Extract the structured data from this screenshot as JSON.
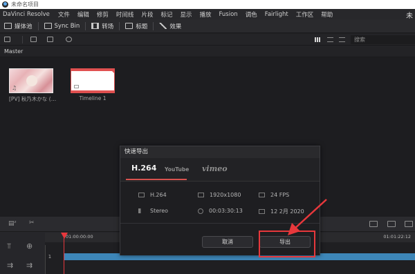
{
  "window": {
    "title": "未命名项目"
  },
  "menu": {
    "app": "DaVinci Resolve",
    "items": [
      "文件",
      "编辑",
      "修剪",
      "时间线",
      "片段",
      "标记",
      "显示",
      "播放",
      "Fusion",
      "调色",
      "Fairlight",
      "工作区",
      "帮助"
    ],
    "corner_text": "未"
  },
  "toolbar": {
    "media_pool": "媒体池",
    "sync_bin": "Sync Bin",
    "transitions": "转场",
    "titles": "标题",
    "effects": "效果"
  },
  "search": {
    "placeholder": "搜索"
  },
  "bin": {
    "name": "Master"
  },
  "clips": [
    {
      "label": "[PV] 秋乃木かな (…"
    },
    {
      "label": "Timeline 1"
    }
  ],
  "timeline": {
    "tc_start": "01:00:00:00",
    "tc_end": "01:01:22:12",
    "track_number": "1"
  },
  "export_dialog": {
    "title": "快速导出",
    "tabs": [
      "H.264",
      "YouTube",
      "vimeo"
    ],
    "active_tab": "H.264",
    "info": {
      "codec": "H.264",
      "resolution": "1920x1080",
      "fps": "24 FPS",
      "audio": "Stereo",
      "duration": "00:03:30:13",
      "date": "12 2月 2020"
    },
    "cancel_label": "取消",
    "export_label": "导出"
  },
  "colors": {
    "accent_red": "#e8383c",
    "track_blue": "#3d86b8",
    "tab_underline": "#d9534f"
  }
}
